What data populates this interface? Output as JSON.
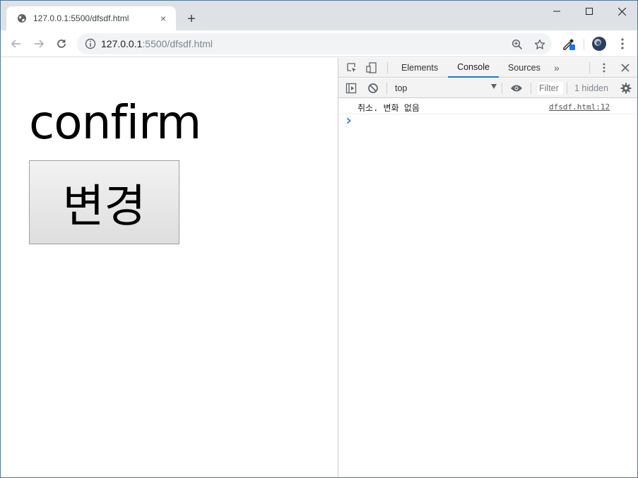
{
  "browser": {
    "tab": {
      "title": "127.0.0.1:5500/dfsdf.html",
      "close": "×"
    },
    "new_tab": "+",
    "url": {
      "host": "127.0.0.1",
      "rest": ":5500/dfsdf.html"
    }
  },
  "page": {
    "heading": "confirm",
    "button_label": "변경"
  },
  "devtools": {
    "tabs": [
      {
        "label": "Elements",
        "active": false
      },
      {
        "label": "Console",
        "active": true
      },
      {
        "label": "Sources",
        "active": false
      }
    ],
    "more_tabs": "»",
    "context": "top",
    "filter_placeholder": "Filter",
    "hidden_count": "1 hidden",
    "messages": [
      {
        "text": "취소. 변화 없음",
        "source": "dfsdf.html:12"
      }
    ]
  },
  "colors": {
    "accent": "#1a73e8",
    "toolbar_bg": "#dee1e6",
    "devtools_bg": "#f3f3f3"
  }
}
